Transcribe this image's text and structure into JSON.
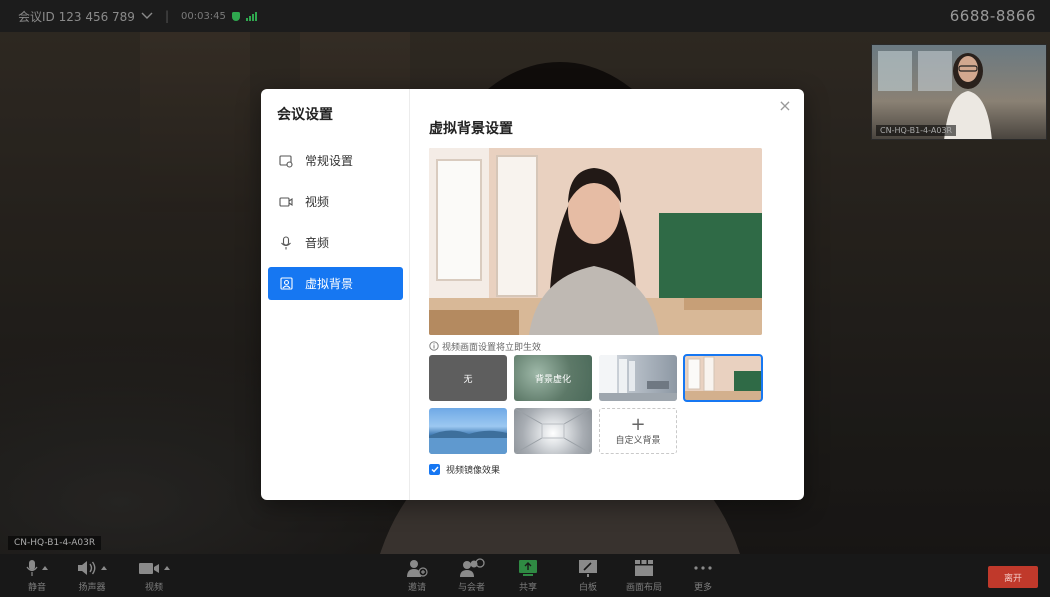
{
  "topbar": {
    "meeting_id": "会议ID 123 456 789",
    "separator": "|",
    "time": "00:03:45",
    "right_text": "6688-8866"
  },
  "stage": {
    "participant_label": "CN-HQ-B1-4-A03R"
  },
  "thumbnail": {
    "label": "CN-HQ-B1-4-A03R"
  },
  "toolbar": {
    "mute": "静音",
    "speaker": "扬声器",
    "video": "视频",
    "invite": "邀请",
    "participants": "与会者",
    "share": "共享",
    "whiteboard": "白板",
    "layout": "画面布局",
    "more": "更多",
    "leave": "离开"
  },
  "modal": {
    "sidebar_title": "会议设置",
    "items": [
      {
        "label": "常规设置",
        "icon": "settings-icon"
      },
      {
        "label": "视频",
        "icon": "camera-icon"
      },
      {
        "label": "音频",
        "icon": "microphone-icon"
      },
      {
        "label": "虚拟背景",
        "icon": "portrait-icon"
      }
    ],
    "active_index": 3,
    "content_title": "虚拟背景设置",
    "note": "视频画面设置将立即生效",
    "backgrounds": [
      {
        "label": "无",
        "type": "none"
      },
      {
        "label": "背景虚化",
        "type": "blur"
      },
      {
        "label": "",
        "type": "office"
      },
      {
        "label": "",
        "type": "room",
        "selected": true
      },
      {
        "label": "",
        "type": "lake"
      },
      {
        "label": "",
        "type": "tunnel"
      }
    ],
    "custom_label": "自定义背景",
    "mirror_label": "视频镜像效果",
    "mirror_checked": true
  },
  "colors": {
    "accent": "#1677f2",
    "leave": "#c0392b",
    "secure": "#2fa84f"
  }
}
